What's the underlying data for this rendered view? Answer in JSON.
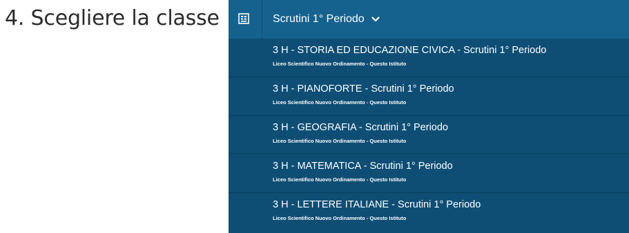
{
  "caption": "4. Scegliere la classe",
  "header": {
    "icon": "register-book-icon",
    "title": "Scrutini 1° Periodo",
    "chevron": "chevron-down-icon"
  },
  "items": [
    {
      "title": "3 H - STORIA ED EDUCAZIONE CIVICA - Scrutini 1° Periodo",
      "subtitle": "Liceo Scientifico Nuovo Ordinamento - Questo Istituto"
    },
    {
      "title": "3 H - PIANOFORTE - Scrutini 1° Periodo",
      "subtitle": "Liceo Scientifico Nuovo Ordinamento - Questo Istituto"
    },
    {
      "title": "3 H - GEOGRAFIA - Scrutini 1° Periodo",
      "subtitle": "Liceo Scientifico Nuovo Ordinamento - Questo Istituto"
    },
    {
      "title": "3 H - MATEMATICA - Scrutini 1° Periodo",
      "subtitle": "Liceo Scientifico Nuovo Ordinamento - Questo Istituto"
    },
    {
      "title": "3 H - LETTERE ITALIANE - Scrutini 1° Periodo",
      "subtitle": "Liceo Scientifico Nuovo Ordinamento - Questo Istituto"
    }
  ],
  "colors": {
    "header_background": "#16628e",
    "list_background": "#0e4e74",
    "text": "#ffffff",
    "caption_text": "#2b2b2b"
  }
}
